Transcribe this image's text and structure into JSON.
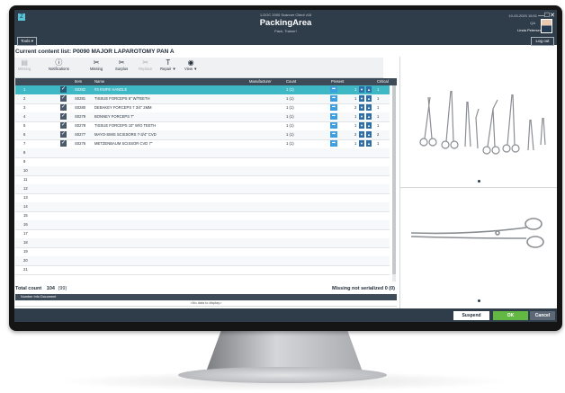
{
  "header": {
    "client": "1-DOC 2000 Scanner Client v16",
    "title": "PackingArea",
    "subtitle": "Pack, Trainer!",
    "datetime": "10-03-2020 15:51",
    "user_line1": "QA",
    "user_name": "Linda Petersen",
    "tools_label": "Tools ▾",
    "logout_label": "Log out",
    "logo_glyph": "Z",
    "minimize_glyph": "—",
    "maximize_glyph": "☐",
    "close_glyph": "✕"
  },
  "content_list_title": "Current content list: P0090 MAJOR LAPAROTOMY PAN A",
  "toolbar": {
    "items": [
      {
        "label": "Missing",
        "icon": "document-icon",
        "glyph": "▤",
        "disabled": true
      },
      {
        "label": "Notifications",
        "icon": "info-icon",
        "glyph": "ⓘ",
        "disabled": false
      },
      {
        "label": "Missing",
        "icon": "scissors-icon",
        "glyph": "✂",
        "disabled": false
      },
      {
        "label": "Surplus",
        "icon": "scissors-icon",
        "glyph": "✂",
        "disabled": false
      },
      {
        "label": "Replace",
        "icon": "scissors-icon",
        "glyph": "✂",
        "disabled": true
      },
      {
        "label": "Repair ▼",
        "icon": "hammer-icon",
        "glyph": "T",
        "disabled": false
      },
      {
        "label": "View ▼",
        "icon": "eye-icon",
        "glyph": "◉",
        "disabled": false
      }
    ]
  },
  "grid": {
    "columns": [
      "Item",
      "Name",
      "Manufacturer",
      "Count",
      "Present",
      "Critical"
    ],
    "rows": [
      {
        "num": "1",
        "checked": true,
        "item": "S0282",
        "name": "#3 KNIFE HANDLE",
        "manufacturer": "",
        "count": "1 (1)",
        "present": "1",
        "critical": "1",
        "selected": true
      },
      {
        "num": "2",
        "checked": true,
        "item": "S0281",
        "name": "TISSUE FORCEPS 6\" W/TEETH",
        "manufacturer": "",
        "count": "1 (1)",
        "present": "1",
        "critical": "1",
        "selected": false
      },
      {
        "num": "3",
        "checked": true,
        "item": "S0280",
        "name": "DEBAKEY FORCEPS 7 3/4\" 2MM",
        "manufacturer": "",
        "count": "1 (1)",
        "present": "2",
        "critical": "1",
        "selected": false
      },
      {
        "num": "4",
        "checked": true,
        "item": "S0279",
        "name": "BONNEY FORCEPS 7\"",
        "manufacturer": "",
        "count": "1 (1)",
        "present": "1",
        "critical": "1",
        "selected": false
      },
      {
        "num": "5",
        "checked": true,
        "item": "S0278",
        "name": "TISSUE FORCEPS 10\" W/O TEETH",
        "manufacturer": "",
        "count": "1 (1)",
        "present": "1",
        "critical": "1",
        "selected": false
      },
      {
        "num": "6",
        "checked": true,
        "item": "S0277",
        "name": "MAYO-SIMS SCISSORS 7-3/4\" CVD",
        "manufacturer": "",
        "count": "1 (1)",
        "present": "2",
        "critical": "2",
        "selected": false
      },
      {
        "num": "7",
        "checked": true,
        "item": "S0276",
        "name": "METZENBAUM SCISSOR CVD 7\"",
        "manufacturer": "",
        "count": "1 (1)",
        "present": "1",
        "critical": "1",
        "selected": false
      },
      {
        "num": "8",
        "checked": false
      },
      {
        "num": "9",
        "checked": false
      },
      {
        "num": "10",
        "checked": false
      },
      {
        "num": "11",
        "checked": false
      },
      {
        "num": "12",
        "checked": false
      },
      {
        "num": "13",
        "checked": false
      },
      {
        "num": "14",
        "checked": false
      },
      {
        "num": "15",
        "checked": false
      },
      {
        "num": "16",
        "checked": false
      },
      {
        "num": "17",
        "checked": false
      },
      {
        "num": "18",
        "checked": false
      },
      {
        "num": "19",
        "checked": false
      },
      {
        "num": "20",
        "checked": false
      },
      {
        "num": "21",
        "checked": false
      }
    ]
  },
  "totals": {
    "label": "Total count",
    "value": "104",
    "paren": "(99)",
    "missing_label": "Missing not serialized",
    "missing_value": "0 (0)"
  },
  "doc_bar": {
    "columns": "Number  Info  Document",
    "no_data": "<No data to display>"
  },
  "footer": {
    "suspend": "Suspend",
    "ok": "OK",
    "cancel": "Cancel"
  },
  "colors": {
    "header_bg": "#2f3c4a",
    "selected_row": "#3eb8c5",
    "ok_green": "#63b843",
    "arrow_blue": "#3a9ee0"
  }
}
